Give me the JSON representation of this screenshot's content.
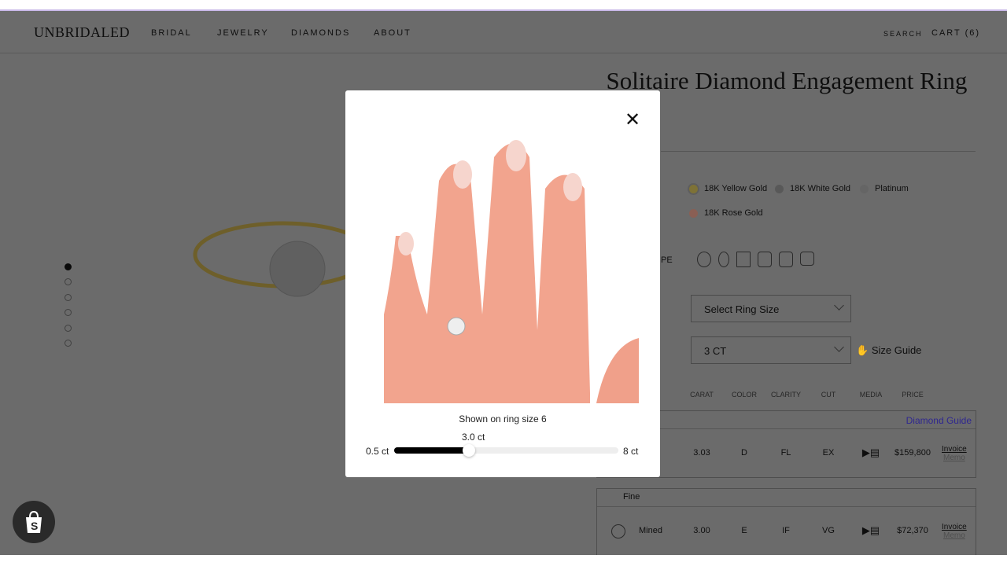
{
  "header": {
    "logo": "UNBRIDALED",
    "nav": [
      "BRIDAL",
      "JEWELRY",
      "DIAMONDS",
      "ABOUT"
    ],
    "search": "SEARCH",
    "cart": "CART (6)"
  },
  "product": {
    "title": "Solitaire Diamond Engagement Ring",
    "shape_label_partial": "PE",
    "metals": [
      {
        "label": "18K Yellow Gold",
        "color": "#c9b25a"
      },
      {
        "label": "18K White Gold",
        "color": "#bdbdbd"
      },
      {
        "label": "Platinum",
        "color": "#e5e5e5"
      },
      {
        "label": "18K Rose Gold",
        "color": "#d9a08e"
      }
    ],
    "ring_size": "Select Ring Size",
    "carat": "3 CT",
    "size_guide": "Size Guide"
  },
  "table": {
    "headers": [
      "CARAT",
      "COLOR",
      "CLARITY",
      "CUT",
      "MEDIA",
      "PRICE"
    ],
    "diamond_guide": "Diamond Guide",
    "link_color": "#4b3bbf",
    "rows": [
      {
        "group": "",
        "origin": "",
        "carat": "3.03",
        "color": "D",
        "clarity": "FL",
        "cut": "EX",
        "price": "$159,800",
        "invoice": "Invoice",
        "memo": "Memo"
      },
      {
        "group": "Fine",
        "origin": "Mined",
        "carat": "3.00",
        "color": "E",
        "clarity": "IF",
        "cut": "VG",
        "price": "$72,370",
        "invoice": "Invoice",
        "memo": "Memo"
      }
    ]
  },
  "modal": {
    "caption": "Shown on ring size 6",
    "slider": {
      "value_label": "3.0 ct",
      "min_label": "0.5 ct",
      "max_label": "8 ct",
      "min": 0.5,
      "max": 8,
      "value": 3.0
    }
  }
}
